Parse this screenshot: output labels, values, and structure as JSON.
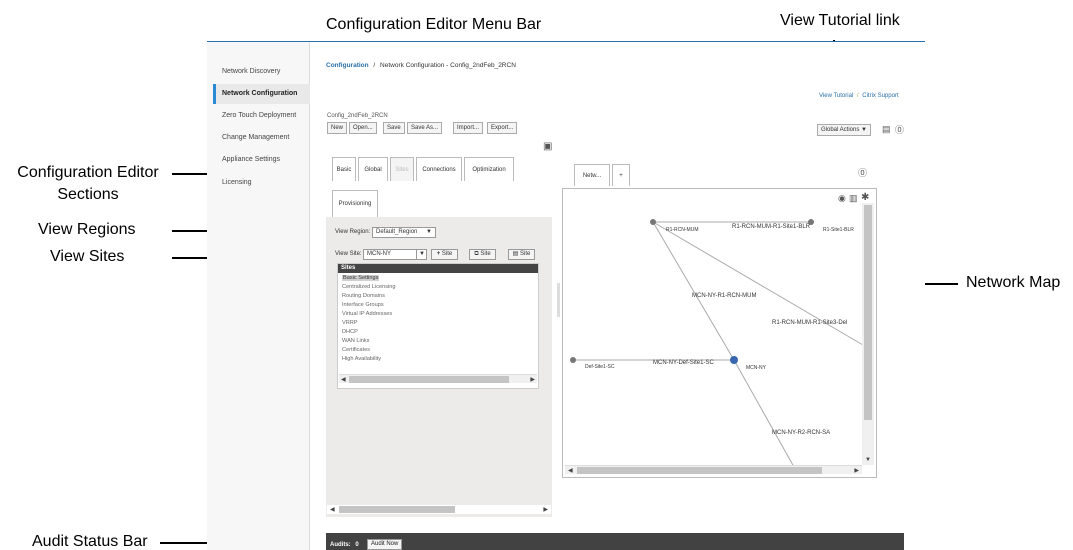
{
  "callouts": {
    "menu_bar": "Configuration Editor Menu Bar",
    "tutorial": "View Tutorial link",
    "sections_line1": "Configuration Editor",
    "sections_line2": "Sections",
    "regions": "View Regions",
    "sites": "View Sites",
    "network_map": "Network Map",
    "audit_bar": "Audit Status Bar"
  },
  "sidebar": {
    "items": [
      {
        "label": "Network Discovery"
      },
      {
        "label": "Network Configuration",
        "active": true
      },
      {
        "label": "Zero Touch Deployment"
      },
      {
        "label": "Change Management"
      },
      {
        "label": "Appliance Settings"
      },
      {
        "label": "Licensing"
      }
    ]
  },
  "breadcrumb": {
    "root": "Configuration",
    "separator": "/",
    "current": "Network Configuration - Config_2ndFeb_2RCN"
  },
  "help": {
    "tutorial": "View Tutorial",
    "separator": "/",
    "support": "Citrix Support"
  },
  "toolbar": {
    "config_name": "Config_2ndFeb_2RCN",
    "new": "New",
    "open": "Open...",
    "save": "Save",
    "save_as": "Save As...",
    "import": "Import...",
    "export": "Export...",
    "global_actions": "Global Actions"
  },
  "editor_tabs": {
    "basic": "Basic",
    "global": "Global",
    "sites": "Sites",
    "connections": "Connections",
    "optimization": "Optimization",
    "provisioning": "Provisioning"
  },
  "region": {
    "label": "View Region:",
    "value": "Default_Region"
  },
  "site": {
    "label": "View Site:",
    "value": "MCN-NY",
    "add": "Site",
    "clone": "Site",
    "delete": "Site"
  },
  "sites_panel": {
    "header": "Sites",
    "items": [
      "Basic Settings",
      "Centralized Licensing",
      "Routing Domains",
      "Interface Groups",
      "Virtual IP Addresses",
      "VRRP",
      "DHCP",
      "WAN Links",
      "Certificates",
      "High Availability"
    ]
  },
  "map_tabs": {
    "network": "Netw...",
    "add": "+"
  },
  "network_map": {
    "nodes": [
      "R1-RCN-MUM",
      "R1-Site1-BLR",
      "Def-Site1-SC",
      "MCN-NY"
    ],
    "links": [
      "R1-RCN-MUM-R1-Site1-BLR",
      "MCN-NY-R1-RCN-MUM",
      "R1-RCN-MUM-R1-Site3-Del",
      "MCN-NY-Def-Site1-SC",
      "MCN-NY-R2-RCN-SA"
    ]
  },
  "audit": {
    "label": "Audits:",
    "count": "0",
    "button": "Audit Now"
  },
  "colors": {
    "accent": "#2a8ad4",
    "link": "#2a6fa8",
    "node_primary": "#3a66b0",
    "node": "#7a7a7a",
    "audit_bar": "#424242"
  }
}
